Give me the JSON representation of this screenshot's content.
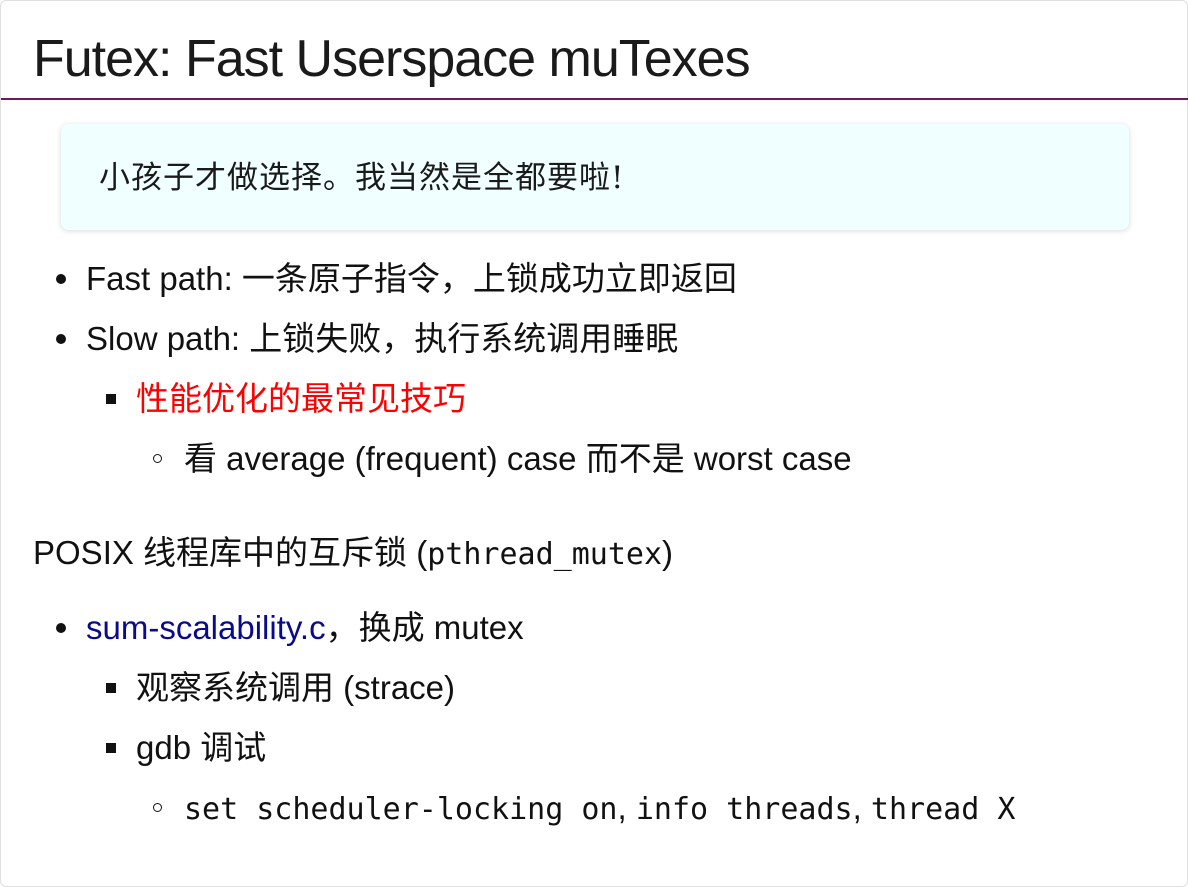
{
  "slide": {
    "title": "Futex: Fast Userspace muTexes",
    "quote": "小孩子才做选择。我当然是全都要啦!",
    "bullets1": {
      "fast_path": "Fast path: 一条原子指令，上锁成功立即返回",
      "slow_path": "Slow path: 上锁失败，执行系统调用睡眠",
      "tip": "性能优化的最常见技巧",
      "tip_detail": "看 average (frequent) case 而不是 worst case"
    },
    "posix": {
      "prefix": "POSIX 线程库中的互斥锁 (",
      "code": "pthread_mutex",
      "suffix": ")"
    },
    "bullets2": {
      "link": "sum-scalability.c",
      "after_link": "，换成 mutex",
      "strace": "观察系统调用 (strace)",
      "gdb": "gdb 调试",
      "cmd1": "set scheduler-locking on",
      "sep1": ", ",
      "cmd2": "info threads",
      "sep2": ", ",
      "cmd3": "thread X"
    }
  },
  "colors": {
    "title_rule": "#6e1a5e",
    "quote_bg": "#f0ffff",
    "highlight": "#ff0000",
    "link": "#0a0a8c"
  }
}
